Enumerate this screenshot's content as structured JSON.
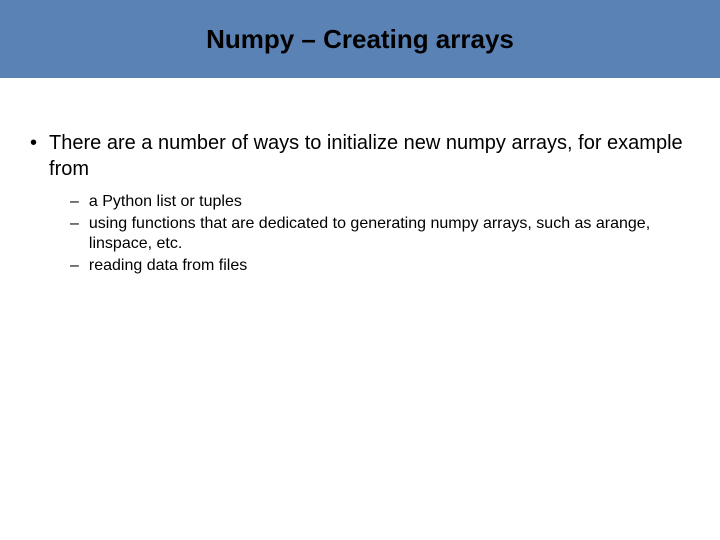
{
  "header": {
    "title": "Numpy – Creating arrays"
  },
  "main": {
    "intro": "There are a number of ways to initialize new numpy arrays, for example from",
    "subitems": [
      "a Python list or tuples",
      "using functions that are dedicated to generating numpy arrays, such as arange, linspace, etc.",
      "reading data from files"
    ]
  }
}
